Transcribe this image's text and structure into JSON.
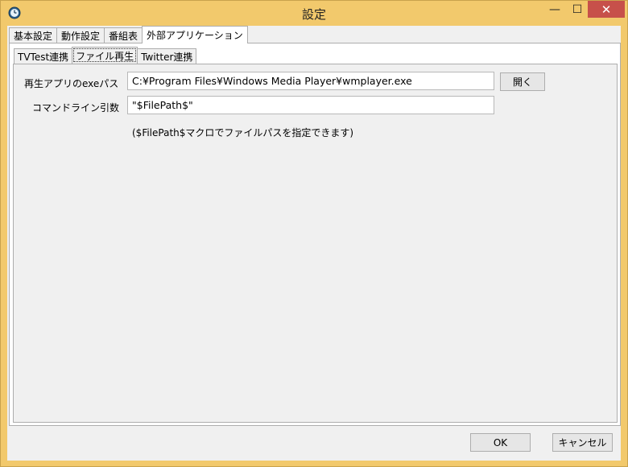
{
  "window": {
    "title": "設定",
    "controls": {
      "minimize": "—",
      "maximize": "☐",
      "close": "✕"
    },
    "colors": {
      "frame": "#f2c96c",
      "close_button": "#c7504a"
    }
  },
  "outer_tabs": [
    {
      "label": "基本設定",
      "active": false
    },
    {
      "label": "動作設定",
      "active": false
    },
    {
      "label": "番組表",
      "active": false
    },
    {
      "label": "外部アプリケーション",
      "active": true
    }
  ],
  "inner_tabs": [
    {
      "label": "TVTest連携",
      "active": false
    },
    {
      "label": "ファイル再生",
      "active": true
    },
    {
      "label": "Twitter連携",
      "active": false
    }
  ],
  "form": {
    "exe_path_label": "再生アプリのexeパス",
    "exe_path_value": "C:¥Program Files¥Windows Media Player¥wmplayer.exe",
    "open_button": "開く",
    "cmdline_label": "コマンドライン引数",
    "cmdline_value": "\"$FilePath$\"",
    "hint": "($FilePath$マクロでファイルパスを指定できます)"
  },
  "footer": {
    "ok": "OK",
    "cancel": "キャンセル"
  }
}
